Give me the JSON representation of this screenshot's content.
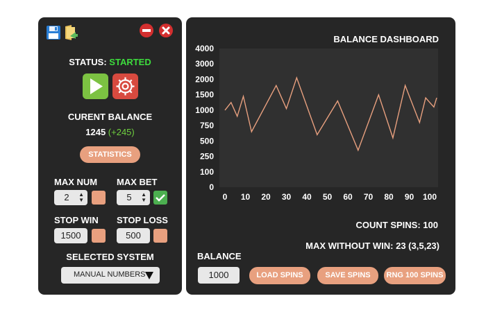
{
  "controls": {
    "status_label": "STATUS:",
    "status_value": "STARTED",
    "balance_title": "CURENT BALANCE",
    "balance_value": "1245",
    "balance_delta": "(+245)",
    "statistics_label": "STATISTICS",
    "max_num_label": "MAX NUM",
    "max_num_value": "2",
    "max_bet_label": "MAX BET",
    "max_bet_value": "5",
    "stop_win_label": "STOP WIN",
    "stop_win_value": "1500",
    "stop_loss_label": "STOP LOSS",
    "stop_loss_value": "500",
    "selected_system_label": "SELECTED SYSTEM",
    "selected_system_value": "MANUAL NUMBERS"
  },
  "dashboard": {
    "title": "BALANCE DASHBOARD",
    "count_spins": "COUNT SPINS: 100",
    "max_without_win": "MAX WITHOUT WIN: 23 (3,5,23)",
    "balance_label": "BALANCE",
    "balance_input": "1000",
    "load_label": "LOAD SPINS",
    "save_label": "SAVE SPINS",
    "rng_label": "RNG 100 SPINS"
  },
  "colors": {
    "panel": "#262626",
    "plot_bg": "#303030",
    "accent": "#e8a07f",
    "status_green": "#3ddc3d",
    "delta_green": "#6fcf3f",
    "line": "#e8a07f"
  },
  "chart_data": {
    "type": "line",
    "xlabel": "",
    "ylabel": "",
    "xlim": [
      0,
      100
    ],
    "ylim": [
      0,
      4000
    ],
    "xticks": [
      "0",
      "10",
      "20",
      "30",
      "40",
      "50",
      "60",
      "70",
      "80",
      "90",
      "100"
    ],
    "yticks": [
      "0",
      "100",
      "250",
      "500",
      "750",
      "1000",
      "1500",
      "2000",
      "3000",
      "4000"
    ],
    "grid": false,
    "series": [
      {
        "x": [
          0,
          3,
          6,
          9,
          13,
          25,
          30,
          35,
          45,
          55,
          65,
          75,
          82,
          88,
          95,
          98,
          100,
          102,
          104
        ],
        "y": [
          1000,
          1250,
          900,
          1450,
          650,
          1800,
          1050,
          2100,
          600,
          1300,
          350,
          1500,
          550,
          1800,
          800,
          1400,
          1250,
          1100,
          1400
        ]
      }
    ]
  }
}
